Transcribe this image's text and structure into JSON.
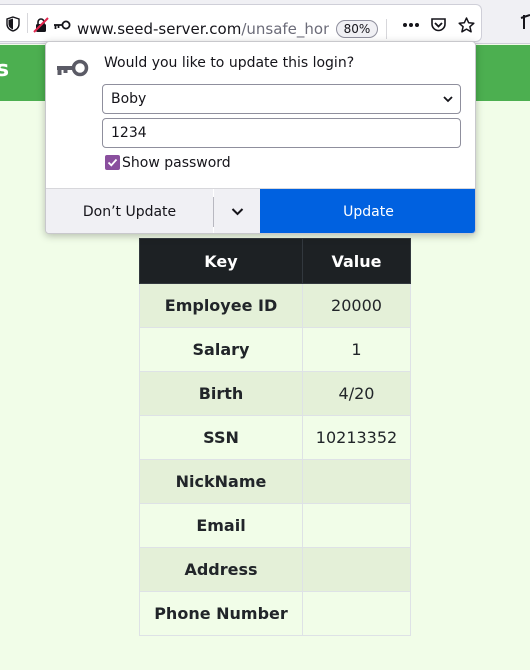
{
  "browser": {
    "url_domain": "www.seed-server.com",
    "url_path": "/unsafe_home",
    "zoom": "80%"
  },
  "popup": {
    "title": "Would you like to update this login?",
    "username": "Boby",
    "password": "1234",
    "show_password": "Show password",
    "dont_update": "Don’t Update",
    "update": "Update"
  },
  "table": {
    "headers": [
      "Key",
      "Value"
    ],
    "rows": [
      [
        "Employee ID",
        "20000"
      ],
      [
        "Salary",
        "1"
      ],
      [
        "Birth",
        "4/20"
      ],
      [
        "SSN",
        "10213352"
      ],
      [
        "NickName",
        ""
      ],
      [
        "Email",
        ""
      ],
      [
        "Address",
        ""
      ],
      [
        "Phone Number",
        ""
      ]
    ]
  },
  "header": {
    "partial_text": "s"
  },
  "colors": {
    "accent": "#0061e0",
    "header_green": "#4caf50",
    "checkbox": "#8a4f9e",
    "table_head": "#1d2124"
  }
}
